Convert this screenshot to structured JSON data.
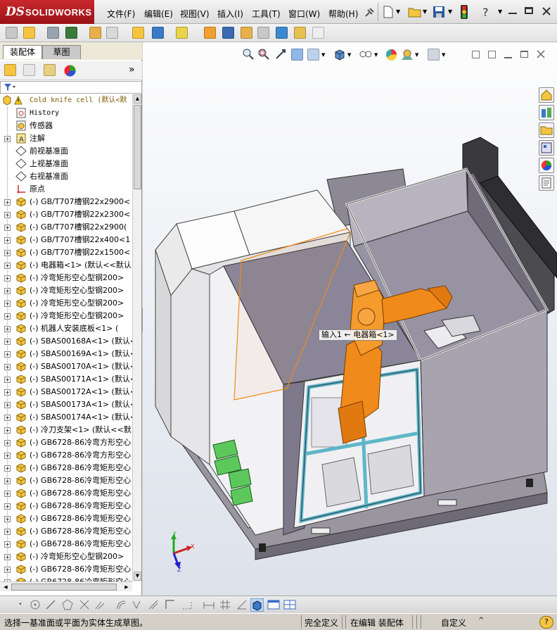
{
  "app": {
    "brand_ds": "DS",
    "brand_name": "SOLIDWORKS"
  },
  "menu": [
    {
      "label": "文件(F)"
    },
    {
      "label": "编辑(E)"
    },
    {
      "label": "视图(V)"
    },
    {
      "label": "插入(I)"
    },
    {
      "label": "工具(T)"
    },
    {
      "label": "窗口(W)"
    },
    {
      "label": "帮助(H)"
    }
  ],
  "panel": {
    "tabs": [
      {
        "label": "装配体"
      },
      {
        "label": "草图"
      }
    ],
    "expand_glyph": "»"
  },
  "tree": [
    {
      "label": "Cold knife cell  (默认<默",
      "pm": "",
      "icon": "assembly-warning",
      "mono": true,
      "indent": 0
    },
    {
      "label": "History",
      "pm": "",
      "icon": "history",
      "mono": true,
      "indent": 1
    },
    {
      "label": "传感器",
      "pm": "",
      "icon": "sensor",
      "mono": false,
      "indent": 1
    },
    {
      "label": "注解",
      "pm": "+",
      "icon": "annotation",
      "mono": false,
      "indent": 1
    },
    {
      "label": "前视基准面",
      "pm": "",
      "icon": "plane",
      "mono": false,
      "indent": 1
    },
    {
      "label": "上视基准面",
      "pm": "",
      "icon": "plane",
      "mono": false,
      "indent": 1
    },
    {
      "label": "右视基准面",
      "pm": "",
      "icon": "plane",
      "mono": false,
      "indent": 1
    },
    {
      "label": "原点",
      "pm": "",
      "icon": "origin",
      "mono": false,
      "indent": 1
    },
    {
      "label": "(-) GB/T707槽钢22x2900<",
      "pm": "+",
      "icon": "part",
      "mono": false,
      "indent": 1
    },
    {
      "label": "(-) GB/T707槽钢22x2300<",
      "pm": "+",
      "icon": "part",
      "mono": false,
      "indent": 1
    },
    {
      "label": "(-) GB/T707槽钢22x2900(",
      "pm": "+",
      "icon": "part",
      "mono": false,
      "indent": 1
    },
    {
      "label": "(-) GB/T707槽钢22x400<1",
      "pm": "+",
      "icon": "part",
      "mono": false,
      "indent": 1
    },
    {
      "label": "(-) GB/T707槽钢22x1500<",
      "pm": "+",
      "icon": "part",
      "mono": false,
      "indent": 1
    },
    {
      "label": "(-) 电器箱<1> (默认<<默认",
      "pm": "+",
      "icon": "part",
      "mono": false,
      "indent": 1
    },
    {
      "label": "(-) 冷弯矩形空心型钢200>",
      "pm": "+",
      "icon": "part",
      "mono": false,
      "indent": 1
    },
    {
      "label": "(-) 冷弯矩形空心型钢200>",
      "pm": "+",
      "icon": "part",
      "mono": false,
      "indent": 1
    },
    {
      "label": "(-) 冷弯矩形空心型钢200>",
      "pm": "+",
      "icon": "part",
      "mono": false,
      "indent": 1
    },
    {
      "label": "(-) 冷弯矩形空心型钢200>",
      "pm": "+",
      "icon": "part",
      "mono": false,
      "indent": 1
    },
    {
      "label": "(-) 机器人安装底板<1> (",
      "pm": "+",
      "icon": "part",
      "mono": false,
      "indent": 1
    },
    {
      "label": "(-) SBAS00168A<1> (默认<",
      "pm": "+",
      "icon": "part",
      "mono": false,
      "indent": 1
    },
    {
      "label": "(-) SBAS00169A<1> (默认<",
      "pm": "+",
      "icon": "part",
      "mono": false,
      "indent": 1
    },
    {
      "label": "(-) SBAS00170A<1> (默认<",
      "pm": "+",
      "icon": "part",
      "mono": false,
      "indent": 1
    },
    {
      "label": "(-) SBAS00171A<1> (默认<",
      "pm": "+",
      "icon": "part",
      "mono": false,
      "indent": 1
    },
    {
      "label": "(-) SBAS00172A<1> (默认<",
      "pm": "+",
      "icon": "part",
      "mono": false,
      "indent": 1
    },
    {
      "label": "(-) SBAS00173A<1> (默认<",
      "pm": "+",
      "icon": "part",
      "mono": false,
      "indent": 1
    },
    {
      "label": "(-) SBAS00174A<1> (默认<",
      "pm": "+",
      "icon": "part",
      "mono": false,
      "indent": 1
    },
    {
      "label": "(-) 冷刀支架<1> (默认<<默",
      "pm": "+",
      "icon": "part",
      "mono": false,
      "indent": 1
    },
    {
      "label": "(-) GB6728-86冷弯方形空心",
      "pm": "+",
      "icon": "part",
      "mono": false,
      "indent": 1
    },
    {
      "label": "(-) GB6728-86冷弯方形空心",
      "pm": "+",
      "icon": "part",
      "mono": false,
      "indent": 1
    },
    {
      "label": "(-) GB6728-86冷弯矩形空心",
      "pm": "+",
      "icon": "part",
      "mono": false,
      "indent": 1
    },
    {
      "label": "(-) GB6728-86冷弯矩形空心",
      "pm": "+",
      "icon": "part",
      "mono": false,
      "indent": 1
    },
    {
      "label": "(-) GB6728-86冷弯矩形空心",
      "pm": "+",
      "icon": "part",
      "mono": false,
      "indent": 1
    },
    {
      "label": "(-) GB6728-86冷弯矩形空心",
      "pm": "+",
      "icon": "part",
      "mono": false,
      "indent": 1
    },
    {
      "label": "(-) GB6728-86冷弯矩形空心",
      "pm": "+",
      "icon": "part",
      "mono": false,
      "indent": 1
    },
    {
      "label": "(-) GB6728-86冷弯矩形空心",
      "pm": "+",
      "icon": "part",
      "mono": false,
      "indent": 1
    },
    {
      "label": "(-) GB6728-86冷弯矩形空心",
      "pm": "+",
      "icon": "part",
      "mono": false,
      "indent": 1
    },
    {
      "label": "(-) 冷弯矩形空心型钢200>",
      "pm": "+",
      "icon": "part",
      "mono": false,
      "indent": 1
    },
    {
      "label": "(-) GB6728-86冷弯矩形空心",
      "pm": "+",
      "icon": "part",
      "mono": false,
      "indent": 1
    },
    {
      "label": "(-) GB6728-86冷弯矩形空心",
      "pm": "+",
      "icon": "part",
      "mono": false,
      "indent": 1
    }
  ],
  "viewport": {
    "tooltip": "输入1 ← 电器箱<1>",
    "triad": {
      "x": "X",
      "y": "Y",
      "z": "Z"
    }
  },
  "status": {
    "message": "选择一基准面或平面为实体生成草图。",
    "definition": "完全定义",
    "mode": "在编辑 装配体",
    "custom": "自定义",
    "caret": "^",
    "help": "?"
  },
  "colors": {
    "brand_red": "#b01c20",
    "robot": "#f08a1a",
    "door_frame": "#5fb6c8",
    "enclosure": "#8e8a9a",
    "panel_white": "#f4f4f4"
  }
}
